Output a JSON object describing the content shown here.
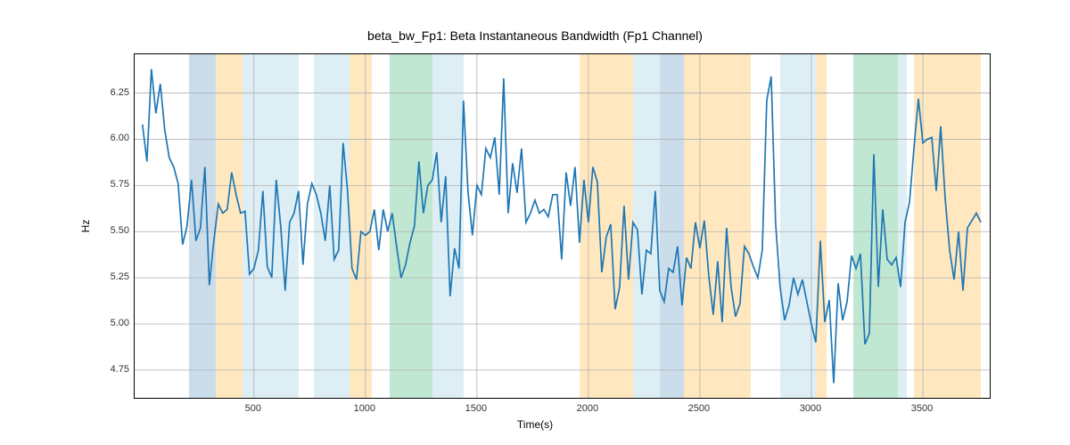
{
  "chart_data": {
    "type": "line",
    "title": "beta_bw_Fp1: Beta Instantaneous Bandwidth (Fp1 Channel)",
    "xlabel": "Time(s)",
    "ylabel": "Hz",
    "xlim": [
      -35,
      3800
    ],
    "ylim": [
      4.6,
      6.46
    ],
    "xticks": [
      500,
      1000,
      1500,
      2000,
      2500,
      3000,
      3500
    ],
    "yticks": [
      4.75,
      5.0,
      5.25,
      5.5,
      5.75,
      6.0,
      6.25
    ],
    "bands": [
      {
        "start": 210,
        "end": 330,
        "cls": "band-blue"
      },
      {
        "start": 330,
        "end": 450,
        "cls": "band-orange"
      },
      {
        "start": 450,
        "end": 700,
        "cls": "band-lightblue"
      },
      {
        "start": 770,
        "end": 930,
        "cls": "band-lightblue"
      },
      {
        "start": 930,
        "end": 1030,
        "cls": "band-orange"
      },
      {
        "start": 1110,
        "end": 1300,
        "cls": "band-green"
      },
      {
        "start": 1300,
        "end": 1440,
        "cls": "band-lightblue"
      },
      {
        "start": 1960,
        "end": 2200,
        "cls": "band-orange"
      },
      {
        "start": 2200,
        "end": 2320,
        "cls": "band-lightblue"
      },
      {
        "start": 2320,
        "end": 2430,
        "cls": "band-blue"
      },
      {
        "start": 2430,
        "end": 2730,
        "cls": "band-orange"
      },
      {
        "start": 2860,
        "end": 3020,
        "cls": "band-lightblue"
      },
      {
        "start": 3020,
        "end": 3070,
        "cls": "band-orange"
      },
      {
        "start": 3190,
        "end": 3390,
        "cls": "band-green"
      },
      {
        "start": 3390,
        "end": 3430,
        "cls": "band-lightblue"
      },
      {
        "start": 3460,
        "end": 3760,
        "cls": "band-orange"
      }
    ],
    "x": [
      0,
      20,
      40,
      60,
      80,
      100,
      120,
      140,
      160,
      180,
      200,
      220,
      240,
      260,
      280,
      300,
      320,
      340,
      360,
      380,
      400,
      420,
      440,
      460,
      480,
      500,
      520,
      540,
      560,
      580,
      600,
      620,
      640,
      660,
      680,
      700,
      720,
      740,
      760,
      780,
      800,
      820,
      840,
      860,
      880,
      900,
      920,
      940,
      960,
      980,
      1000,
      1020,
      1040,
      1060,
      1080,
      1100,
      1120,
      1140,
      1160,
      1180,
      1200,
      1220,
      1240,
      1260,
      1280,
      1300,
      1320,
      1340,
      1360,
      1380,
      1400,
      1420,
      1440,
      1460,
      1480,
      1500,
      1520,
      1540,
      1560,
      1580,
      1600,
      1620,
      1640,
      1660,
      1680,
      1700,
      1720,
      1740,
      1760,
      1780,
      1800,
      1820,
      1840,
      1860,
      1880,
      1900,
      1920,
      1940,
      1960,
      1980,
      2000,
      2020,
      2040,
      2060,
      2080,
      2100,
      2120,
      2140,
      2160,
      2180,
      2200,
      2220,
      2240,
      2260,
      2280,
      2300,
      2320,
      2340,
      2360,
      2380,
      2400,
      2420,
      2440,
      2460,
      2480,
      2500,
      2520,
      2540,
      2560,
      2580,
      2600,
      2620,
      2640,
      2660,
      2680,
      2700,
      2720,
      2740,
      2760,
      2780,
      2800,
      2820,
      2840,
      2860,
      2880,
      2900,
      2920,
      2940,
      2960,
      2980,
      3000,
      3020,
      3040,
      3060,
      3080,
      3100,
      3120,
      3140,
      3160,
      3180,
      3200,
      3220,
      3240,
      3260,
      3280,
      3300,
      3320,
      3340,
      3360,
      3380,
      3400,
      3420,
      3440,
      3460,
      3480,
      3500,
      3520,
      3540,
      3560,
      3580,
      3600,
      3620,
      3640,
      3660,
      3680,
      3700,
      3720,
      3740,
      3760
    ],
    "values": [
      6.08,
      5.88,
      6.38,
      6.14,
      6.3,
      6.05,
      5.9,
      5.85,
      5.76,
      5.43,
      5.53,
      5.78,
      5.45,
      5.52,
      5.85,
      5.21,
      5.45,
      5.65,
      5.6,
      5.62,
      5.82,
      5.7,
      5.6,
      5.61,
      5.27,
      5.3,
      5.4,
      5.72,
      5.31,
      5.25,
      5.78,
      5.53,
      5.18,
      5.55,
      5.6,
      5.72,
      5.32,
      5.65,
      5.76,
      5.7,
      5.6,
      5.45,
      5.75,
      5.35,
      5.4,
      5.98,
      5.72,
      5.3,
      5.24,
      5.5,
      5.48,
      5.5,
      5.62,
      5.4,
      5.62,
      5.5,
      5.6,
      5.42,
      5.25,
      5.32,
      5.44,
      5.53,
      5.88,
      5.6,
      5.75,
      5.78,
      5.93,
      5.55,
      5.8,
      5.15,
      5.41,
      5.3,
      6.21,
      5.72,
      5.48,
      5.75,
      5.7,
      5.95,
      5.9,
      6.01,
      5.7,
      6.33,
      5.6,
      5.87,
      5.71,
      5.95,
      5.55,
      5.6,
      5.67,
      5.6,
      5.62,
      5.58,
      5.7,
      5.7,
      5.35,
      5.82,
      5.64,
      5.85,
      5.44,
      5.78,
      5.55,
      5.85,
      5.77,
      5.28,
      5.47,
      5.54,
      5.08,
      5.2,
      5.64,
      5.24,
      5.55,
      5.51,
      5.16,
      5.4,
      5.38,
      5.72,
      5.18,
      5.12,
      5.3,
      5.28,
      5.42,
      5.1,
      5.36,
      5.3,
      5.55,
      5.41,
      5.56,
      5.26,
      5.05,
      5.34,
      5.01,
      5.52,
      5.2,
      5.04,
      5.11,
      5.42,
      5.38,
      5.31,
      5.25,
      5.4,
      6.21,
      6.34,
      5.54,
      5.2,
      5.02,
      5.1,
      5.25,
      5.16,
      5.24,
      5.12,
      5.0,
      4.9,
      5.45,
      5.01,
      5.13,
      4.68,
      5.22,
      5.02,
      5.12,
      5.37,
      5.3,
      5.38,
      4.89,
      4.95,
      5.92,
      5.2,
      5.62,
      5.35,
      5.32,
      5.36,
      5.2,
      5.55,
      5.66,
      5.95,
      6.22,
      5.98,
      6.0,
      6.01,
      5.72,
      6.07,
      5.68,
      5.4,
      5.24,
      5.5,
      5.18,
      5.52,
      5.56,
      5.6,
      5.55
    ]
  }
}
